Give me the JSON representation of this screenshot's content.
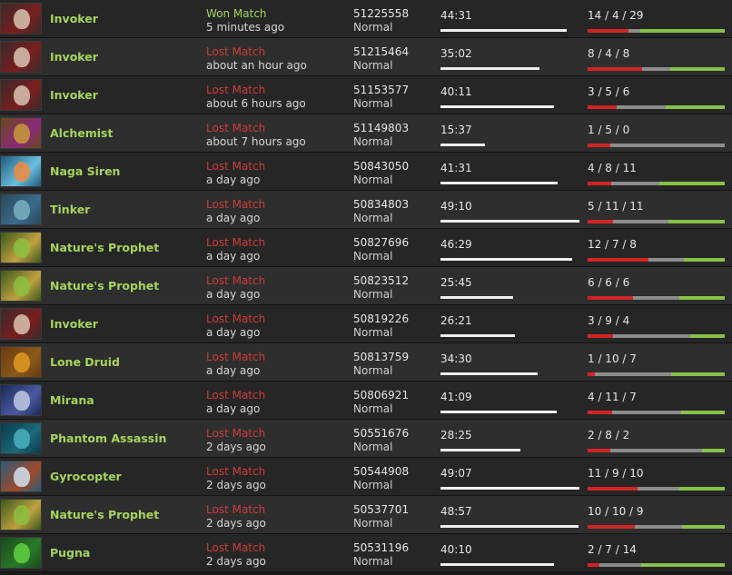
{
  "colors": {
    "hero_name": "#a6d55b",
    "won": "#a6d55b",
    "lost": "#cc3b3b",
    "kills_bar": "#d12525",
    "deaths_bar": "#8c8c8c",
    "assists_bar": "#86c246",
    "duration_bar": "#f0f0f0"
  },
  "matches": [
    {
      "hero": "Invoker",
      "icon": "invoker-portrait-icon",
      "result": "Won Match",
      "won": true,
      "ago": "5 minutes ago",
      "match_id": "51225558",
      "mode": "Normal",
      "duration": "44:31",
      "kda": "14 / 4 / 29",
      "k": 14,
      "d": 4,
      "a": 29
    },
    {
      "hero": "Invoker",
      "icon": "invoker-portrait-icon",
      "result": "Lost Match",
      "won": false,
      "ago": "about an hour ago",
      "match_id": "51215464",
      "mode": "Normal",
      "duration": "35:02",
      "kda": "8 / 4 / 8",
      "k": 8,
      "d": 4,
      "a": 8
    },
    {
      "hero": "Invoker",
      "icon": "invoker-portrait-icon",
      "result": "Lost Match",
      "won": false,
      "ago": "about 6 hours ago",
      "match_id": "51153577",
      "mode": "Normal",
      "duration": "40:11",
      "kda": "3 / 5 / 6",
      "k": 3,
      "d": 5,
      "a": 6
    },
    {
      "hero": "Alchemist",
      "icon": "alchemist-portrait-icon",
      "result": "Lost Match",
      "won": false,
      "ago": "about 7 hours ago",
      "match_id": "51149803",
      "mode": "Normal",
      "duration": "15:37",
      "kda": "1 / 5 / 0",
      "k": 1,
      "d": 5,
      "a": 0
    },
    {
      "hero": "Naga Siren",
      "icon": "naga-siren-portrait-icon",
      "result": "Lost Match",
      "won": false,
      "ago": "a day ago",
      "match_id": "50843050",
      "mode": "Normal",
      "duration": "41:31",
      "kda": "4 / 8 / 11",
      "k": 4,
      "d": 8,
      "a": 11
    },
    {
      "hero": "Tinker",
      "icon": "tinker-portrait-icon",
      "result": "Lost Match",
      "won": false,
      "ago": "a day ago",
      "match_id": "50834803",
      "mode": "Normal",
      "duration": "49:10",
      "kda": "5 / 11 / 11",
      "k": 5,
      "d": 11,
      "a": 11
    },
    {
      "hero": "Nature's Prophet",
      "icon": "natures-prophet-portrait-icon",
      "result": "Lost Match",
      "won": false,
      "ago": "a day ago",
      "match_id": "50827696",
      "mode": "Normal",
      "duration": "46:29",
      "kda": "12 / 7 / 8",
      "k": 12,
      "d": 7,
      "a": 8
    },
    {
      "hero": "Nature's Prophet",
      "icon": "natures-prophet-portrait-icon",
      "result": "Lost Match",
      "won": false,
      "ago": "a day ago",
      "match_id": "50823512",
      "mode": "Normal",
      "duration": "25:45",
      "kda": "6 / 6 / 6",
      "k": 6,
      "d": 6,
      "a": 6
    },
    {
      "hero": "Invoker",
      "icon": "invoker-portrait-icon",
      "result": "Lost Match",
      "won": false,
      "ago": "a day ago",
      "match_id": "50819226",
      "mode": "Normal",
      "duration": "26:21",
      "kda": "3 / 9 / 4",
      "k": 3,
      "d": 9,
      "a": 4
    },
    {
      "hero": "Lone Druid",
      "icon": "lone-druid-portrait-icon",
      "result": "Lost Match",
      "won": false,
      "ago": "a day ago",
      "match_id": "50813759",
      "mode": "Normal",
      "duration": "34:30",
      "kda": "1 / 10 / 7",
      "k": 1,
      "d": 10,
      "a": 7
    },
    {
      "hero": "Mirana",
      "icon": "mirana-portrait-icon",
      "result": "Lost Match",
      "won": false,
      "ago": "a day ago",
      "match_id": "50806921",
      "mode": "Normal",
      "duration": "41:09",
      "kda": "4 / 11 / 7",
      "k": 4,
      "d": 11,
      "a": 7
    },
    {
      "hero": "Phantom Assassin",
      "icon": "phantom-assassin-portrait-icon",
      "result": "Lost Match",
      "won": false,
      "ago": "2 days ago",
      "match_id": "50551676",
      "mode": "Normal",
      "duration": "28:25",
      "kda": "2 / 8 / 2",
      "k": 2,
      "d": 8,
      "a": 2
    },
    {
      "hero": "Gyrocopter",
      "icon": "gyrocopter-portrait-icon",
      "result": "Lost Match",
      "won": false,
      "ago": "2 days ago",
      "match_id": "50544908",
      "mode": "Normal",
      "duration": "49:07",
      "kda": "11 / 9 / 10",
      "k": 11,
      "d": 9,
      "a": 10
    },
    {
      "hero": "Nature's Prophet",
      "icon": "natures-prophet-portrait-icon",
      "result": "Lost Match",
      "won": false,
      "ago": "2 days ago",
      "match_id": "50537701",
      "mode": "Normal",
      "duration": "48:57",
      "kda": "10 / 10 / 9",
      "k": 10,
      "d": 10,
      "a": 9
    },
    {
      "hero": "Pugna",
      "icon": "pugna-portrait-icon",
      "result": "Lost Match",
      "won": false,
      "ago": "2 days ago",
      "match_id": "50531196",
      "mode": "Normal",
      "duration": "40:10",
      "kda": "2 / 7 / 14",
      "k": 2,
      "d": 7,
      "a": 14
    }
  ]
}
